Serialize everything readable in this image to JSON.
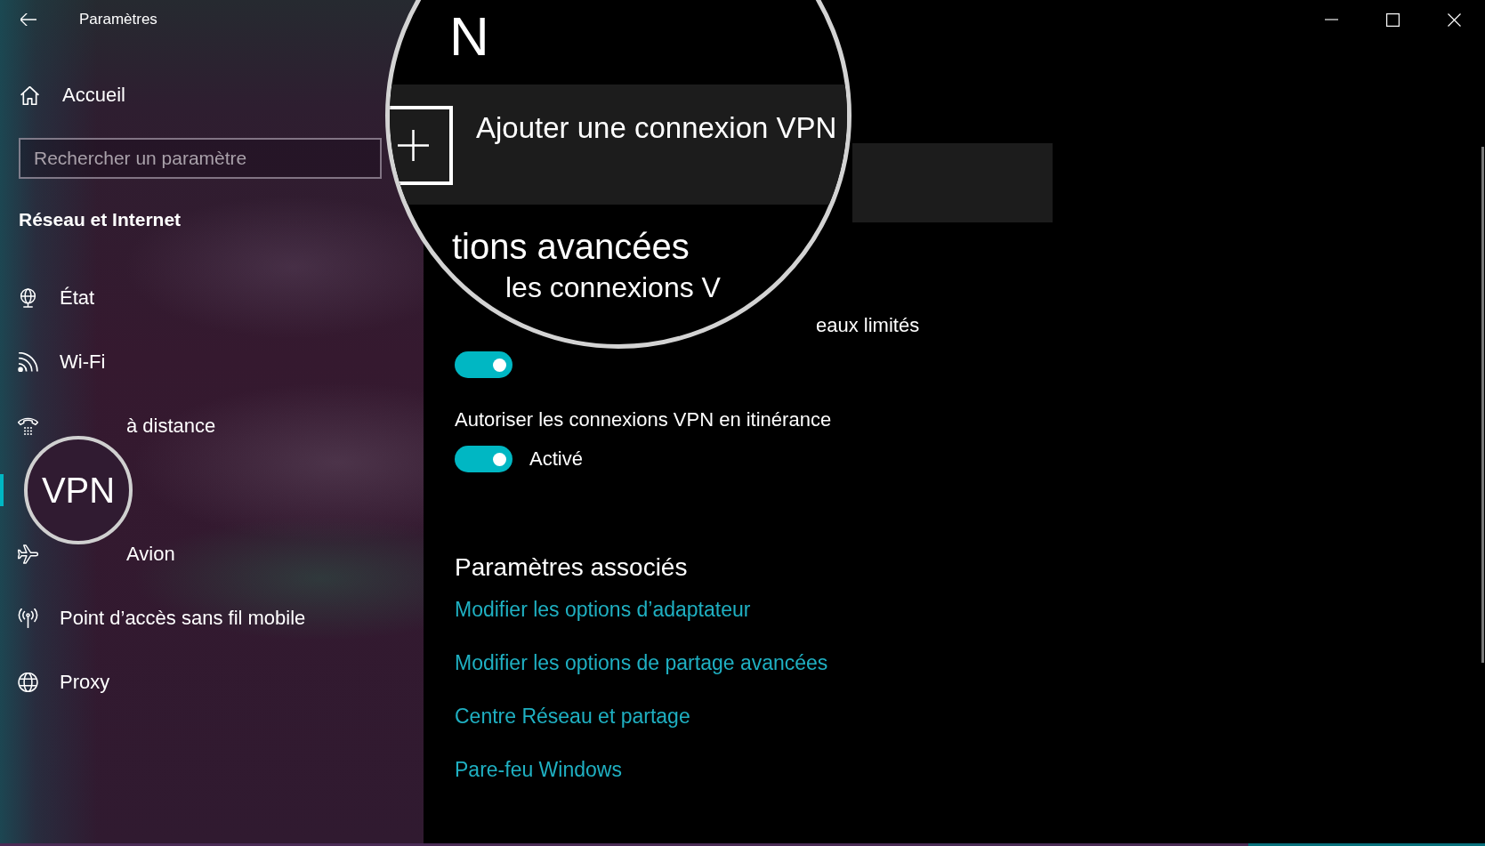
{
  "window": {
    "title": "Paramètres"
  },
  "sidebar": {
    "home": {
      "label": "Accueil"
    },
    "search": {
      "placeholder": "Rechercher un paramètre"
    },
    "section_title": "Réseau et Internet",
    "items": [
      {
        "label": "État",
        "selected": false,
        "partly_hidden": false
      },
      {
        "label": "Wi-Fi",
        "selected": false,
        "partly_hidden": false
      },
      {
        "label": "à distance",
        "selected": false,
        "partly_hidden": true
      },
      {
        "selected": true
      },
      {
        "label": "Avion",
        "selected": false,
        "partly_hidden": true
      },
      {
        "label": "Point d’accès sans fil mobile",
        "selected": false,
        "partly_hidden": false
      },
      {
        "label": "Proxy",
        "selected": false,
        "partly_hidden": false
      }
    ]
  },
  "main": {
    "settings": [
      {
        "label": "eaux limités",
        "partly_hidden": true,
        "on": true
      },
      {
        "label": "Autoriser les connexions VPN en itinérance",
        "partly_hidden": false,
        "on": true,
        "state_label": "Activé"
      }
    ],
    "related": {
      "title": "Paramètres associés",
      "links": [
        "Modifier les options d’adaptateur",
        "Modifier les options de partage avancées",
        "Centre Réseau et partage",
        "Pare-feu Windows"
      ]
    }
  },
  "sidebar_magnifier": {
    "label": "VPN"
  },
  "content_magnifier": {
    "title": "N",
    "add_button": {
      "label": "Ajouter une connexion VPN"
    },
    "heading": "tions avancées",
    "setting_label": "les connexions V"
  }
}
